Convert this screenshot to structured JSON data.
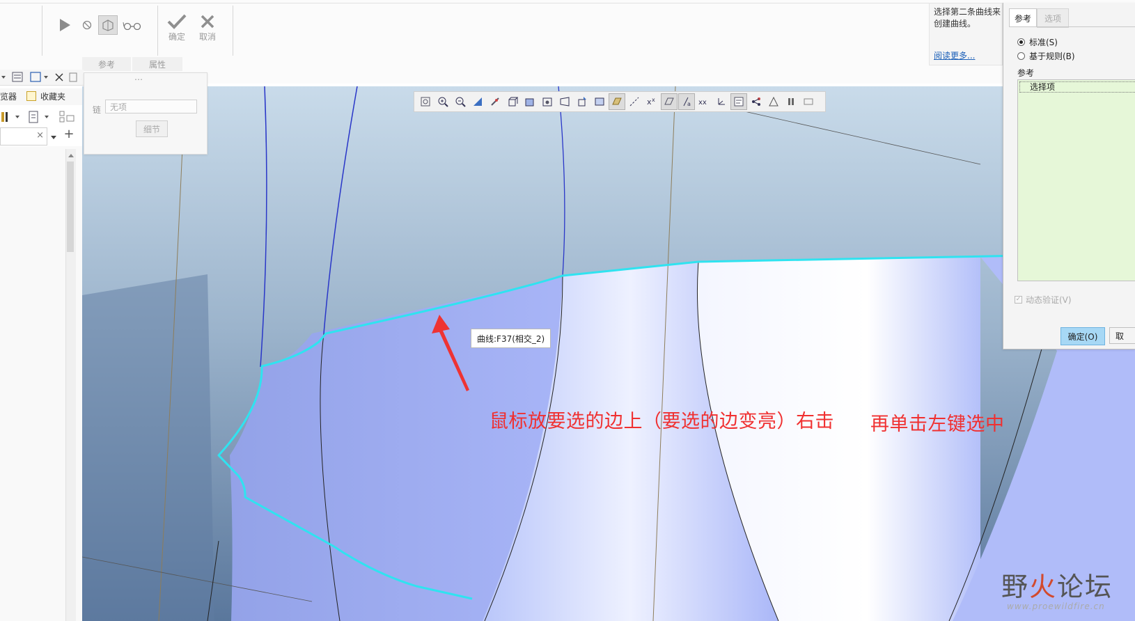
{
  "ribbon": {
    "confirm_label": "确定",
    "cancel_label": "取消",
    "subtabs": [
      "参考",
      "属性"
    ]
  },
  "ref_panel": {
    "dots": "⋯",
    "chain_label": "链",
    "chain_value": "无项",
    "detail_button": "细节"
  },
  "left_panel": {
    "tab_filter": "览器",
    "tab_favorites": "收藏夹"
  },
  "viewport": {
    "tooltip": "曲线:F37(相交_2)",
    "annotation_1": "鼠标放要选的边上（要选的边变亮）右击",
    "annotation_2": "再单击左键选中",
    "highlight_color": "#2fe3f0",
    "surface_color": "#a7b4f7"
  },
  "help": {
    "text": "选择第二条曲线来创建曲线。",
    "link": "阅读更多..."
  },
  "dialog": {
    "tab_ref": "参考",
    "tab_options": "选项",
    "radio_standard": "标准(S)",
    "radio_rule": "基于规则(B)",
    "group_label": "参考",
    "list_item": "选择项",
    "dynamic_verify": "动态验证(V)",
    "ok": "确定(O)",
    "cancel": "取"
  },
  "watermark": {
    "brand_part1": "野",
    "brand_part2": "火",
    "brand_part3": "论坛",
    "url": "www.proewildfire.cn"
  }
}
